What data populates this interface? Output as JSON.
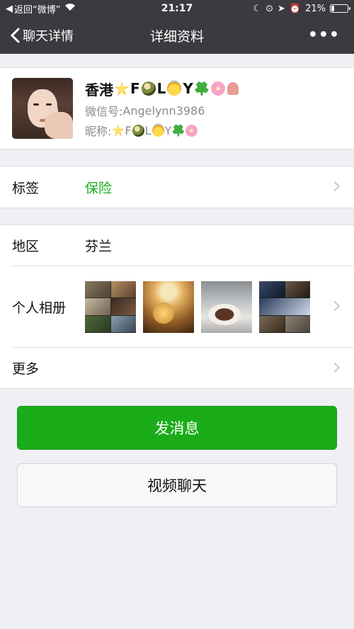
{
  "status_bar": {
    "back_app": "返回“微博”",
    "time": "21:17",
    "battery_percent": "21%",
    "battery_level": 0.21,
    "icons": [
      "moon-icon",
      "rotation-lock-icon",
      "location-arrow-icon",
      "alarm-icon",
      "battery-icon"
    ]
  },
  "nav": {
    "back_label": "聊天详情",
    "title": "详细资料",
    "more_label": "•••"
  },
  "profile": {
    "name_prefix": "香港",
    "name_letters": [
      "F",
      "L",
      "Y"
    ],
    "wechat_id_label": "微信号: ",
    "wechat_id": "Angelynn3986",
    "nickname_label": "昵称: ",
    "nickname_letters": [
      "F",
      "L",
      "Y"
    ]
  },
  "tags": {
    "label": "标签",
    "value": "保险",
    "value_color": "#1aad19"
  },
  "info": {
    "region_label": "地区",
    "region_value": "芬兰",
    "album_label": "个人相册",
    "more_label": "更多"
  },
  "actions": {
    "message_button": "发消息",
    "video_button": "视频聊天",
    "primary_color": "#1aad19"
  }
}
